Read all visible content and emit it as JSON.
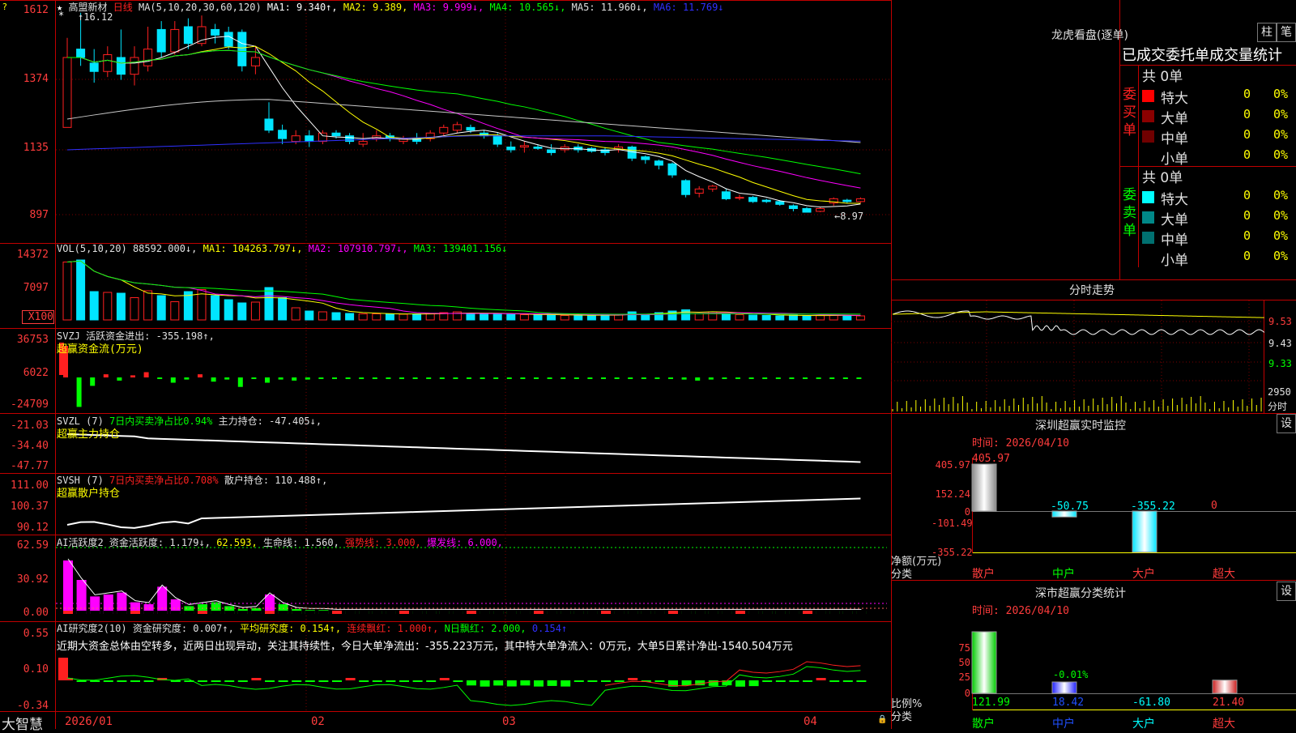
{
  "colors": {
    "up": "#ff2020",
    "down": "#00e5ff",
    "green": "#00ff00",
    "yellow": "#ffff00",
    "magenta": "#ff00ff",
    "white": "#ffffff",
    "blue": "#3030ff",
    "grid": "#c00000"
  },
  "main": {
    "stock": "高盟新材",
    "period": "日线",
    "ma_label": "MA(5,10,20,30,60,120)",
    "ma1": "MA1: 9.340↑,",
    "ma2": "MA2: 9.389,",
    "ma3": "MA3: 9.999↓,",
    "ma4": "MA4: 10.565↓,",
    "ma5": "MA5: 11.960↓,",
    "ma6": "MA6: 11.769↓",
    "high_mark": "16.12",
    "low_mark": "8.97",
    "y_ticks": [
      "1612",
      "1374",
      "1135",
      "897"
    ]
  },
  "vol": {
    "label": "VOL(5,10,20)",
    "value": "88592.000↓,",
    "ma1": "MA1: 104263.797↓,",
    "ma2": "MA2: 107910.797↓,",
    "ma3": "MA3: 139401.156↓",
    "y_ticks": [
      "14372",
      "7097",
      "X100"
    ]
  },
  "svzj": {
    "label": "SVZJ  活跃资金进出: -355.198↑,",
    "sub": "超赢资金流(万元)",
    "y_ticks": [
      "36753",
      "6022",
      "-24709"
    ]
  },
  "svzl": {
    "label": "SVZL  (7)",
    "net": "7日内买卖净占比0.94%",
    "hold": "主力持仓: -47.405↓,",
    "sub": "超赢主力持仓",
    "y_ticks": [
      "-21.03",
      "-34.40",
      "-47.77"
    ]
  },
  "svsh": {
    "label": "SVSH  (7)",
    "net": "7日内买卖净占比0.708%",
    "hold": "散户持仓: 110.488↑,",
    "sub": "超赢散户持仓",
    "y_ticks": [
      "111.00",
      "100.37",
      "90.12"
    ]
  },
  "ai1": {
    "label": "AI活跃度2",
    "v1": "资金活跃度: 1.179↓,",
    "v2": "62.593,",
    "v3": "生命线: 1.560,",
    "v4": "强势线: 3.000,",
    "v5": "爆发线: 6.000,",
    "y_ticks": [
      "62.59",
      "30.92",
      "0.00"
    ]
  },
  "ai2": {
    "label": "AI研究度2(10)",
    "v1": "资金研究度: 0.007↑,",
    "v2": "平均研究度: 0.154↑,",
    "v3": "连续飘红: 1.000↑,",
    "v4": "N日飘红: 2.000,",
    "v5": "0.154↑",
    "comment": "近期大资金总体由空转多，近两日出现异动，关注其持续性，今日大单净流出：-355.223万元，其中特大单净流入：0万元，大单5日累计净出-1540.504万元",
    "y_ticks": [
      "0.55",
      "0.10",
      "-0.34"
    ]
  },
  "xaxis": {
    "brand": "大智慧",
    "labels": [
      "2026/01",
      "02",
      "03",
      "04"
    ]
  },
  "lhb": {
    "title": "龙虎看盘(逐单)",
    "btn1": "柱",
    "btn2": "笔",
    "subtitle": "已成交委托单成交量统计",
    "buy": {
      "side": "委买单",
      "total": "共 0单",
      "rows": [
        {
          "name": "特大",
          "v": "0",
          "p": "0%",
          "color": "#ff0000"
        },
        {
          "name": "大单",
          "v": "0",
          "p": "0%",
          "color": "#8b0000"
        },
        {
          "name": "中单",
          "v": "0",
          "p": "0%",
          "color": "#700000"
        },
        {
          "name": "小单",
          "v": "0",
          "p": "0%",
          "color": ""
        }
      ]
    },
    "sell": {
      "side": "委卖单",
      "total": "共 0单",
      "rows": [
        {
          "name": "特大",
          "v": "0",
          "p": "0%",
          "color": "#00ffff"
        },
        {
          "name": "大单",
          "v": "0",
          "p": "0%",
          "color": "#008888"
        },
        {
          "name": "中单",
          "v": "0",
          "p": "0%",
          "color": "#007070"
        },
        {
          "name": "小单",
          "v": "0",
          "p": "0%",
          "color": ""
        }
      ]
    }
  },
  "intraday": {
    "title": "分时走势",
    "y_ticks": [
      "9.53",
      "9.43",
      "9.33"
    ],
    "vol_ticks": [
      "2950",
      "分时"
    ]
  },
  "sz_monitor": {
    "title": "深圳超赢实时监控",
    "btn": "设",
    "time": "时间: 2026/04/10",
    "y_ticks": [
      "405.97",
      "152.24",
      "0",
      "-101.49",
      "-355.22"
    ],
    "ylabel": "净额(万元)",
    "xlabel": "分类",
    "bars": [
      {
        "cat": "散户",
        "value": 405.97,
        "label": "405.97"
      },
      {
        "cat": "中户",
        "value": -50.75,
        "label": "-50.75"
      },
      {
        "cat": "大户",
        "value": -355.22,
        "label": "-355.22"
      },
      {
        "cat": "超大",
        "value": 0,
        "label": "0"
      }
    ]
  },
  "sz_stats": {
    "title": "深市超赢分类统计",
    "btn": "设",
    "time": "时间: 2026/04/10",
    "y_ticks": [
      "75",
      "50",
      "25",
      "0"
    ],
    "ylabel": "比例%",
    "xlabel": "分类",
    "mid_label": "-0.01%",
    "bars": [
      {
        "cat": "散户",
        "value": 121.99,
        "label": "121.99"
      },
      {
        "cat": "中户",
        "value": 18.42,
        "label": "18.42"
      },
      {
        "cat": "大户",
        "value": -61.8,
        "label": "-61.80"
      },
      {
        "cat": "超大",
        "value": 21.4,
        "label": "21.40"
      }
    ]
  }
}
